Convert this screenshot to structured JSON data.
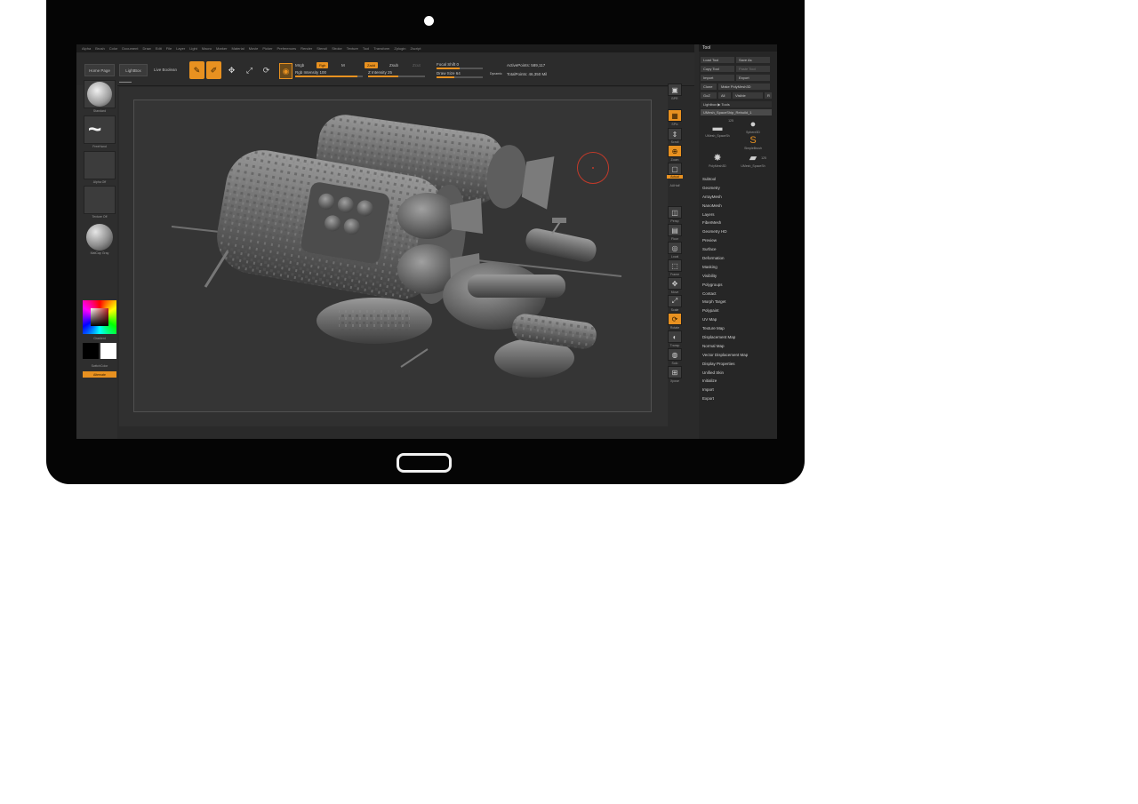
{
  "menu": [
    "Alpha",
    "Brush",
    "Color",
    "Document",
    "Draw",
    "Edit",
    "File",
    "Layer",
    "Light",
    "Macro",
    "Marker",
    "Material",
    "Movie",
    "Picker",
    "Preferences",
    "Render",
    "Stencil",
    "Stroke",
    "Texture",
    "Tool",
    "Transform",
    "Zplugin",
    "Zscript"
  ],
  "toolbar": {
    "home_page": "Home Page",
    "lightbox": "LightBox",
    "live_boolean": "Live Boolean",
    "edit": "Edit",
    "draw": "Draw",
    "move": "Move",
    "scale": "Scale",
    "rotate": "Rotate",
    "mrgb": "Mrgb",
    "rgb": "Rgb",
    "m": "M",
    "rgb_intensity": "Rgb Intensity 100",
    "zadd": "Zadd",
    "zsub": "Zsub",
    "zcut": "Zcut",
    "z_intensity": "Z Intensity 25",
    "focal_shift": "Focal Shift 0",
    "draw_size": "Draw Size 64",
    "dynamic": "Dynamic",
    "active_points": "ActivePoints: 589,117",
    "total_points": "TotalPoints: 46,350 Mil"
  },
  "left_tray": {
    "brush": "Standard",
    "stroke": "FreeHand",
    "alpha": "Alpha Off",
    "texture": "Texture Off",
    "material": "MatCap Gray",
    "gradient": "Gradient",
    "switch_color": "SwitchColor",
    "alternate": "Alternate"
  },
  "right_shelf": [
    "BPR",
    "SPix",
    "Scroll",
    "Zoom",
    "Actual",
    "AAHalf",
    "Persp",
    "Floor",
    "Local",
    "Frame",
    "Move",
    "Scale",
    "Rotate",
    "Transp",
    "Solo",
    "Xpose"
  ],
  "tool_palette": {
    "title": "Tool",
    "load_tool": "Load Tool",
    "save_as": "Save As",
    "copy_tool": "Copy Tool",
    "paste_tool": "Paste Tool",
    "import": "Import",
    "export": "Export",
    "clone": "Clone",
    "make_polymesh": "Make PolyMesh3D",
    "goz": "GoZ",
    "all": "All",
    "visible": "Visible",
    "r": "R",
    "lightbox_tools": "Lightbox ▶ Tools",
    "current_tool": "UMesh_SpaceShip_Rebuild_1",
    "count_a": "125",
    "count_b": "125",
    "thumbs": [
      "UMesh_SpaceSh",
      "Sphere3D",
      "SimpleBrush",
      "PolyMesh3D",
      "UMesh_SpaceSh"
    ],
    "subpalettes": [
      "Subtool",
      "Geometry",
      "ArrayMesh",
      "NanoMesh",
      "Layers",
      "FiberMesh",
      "Geometry HD",
      "Preview",
      "Surface",
      "Deformation",
      "Masking",
      "Visibility",
      "Polygroups",
      "Contact",
      "Morph Target",
      "Polypaint",
      "UV Map",
      "Texture Map",
      "Displacement Map",
      "Normal Map",
      "Vector Displacement Map",
      "Display Properties",
      "Unified Skin",
      "Initialize",
      "Import",
      "Export"
    ]
  }
}
